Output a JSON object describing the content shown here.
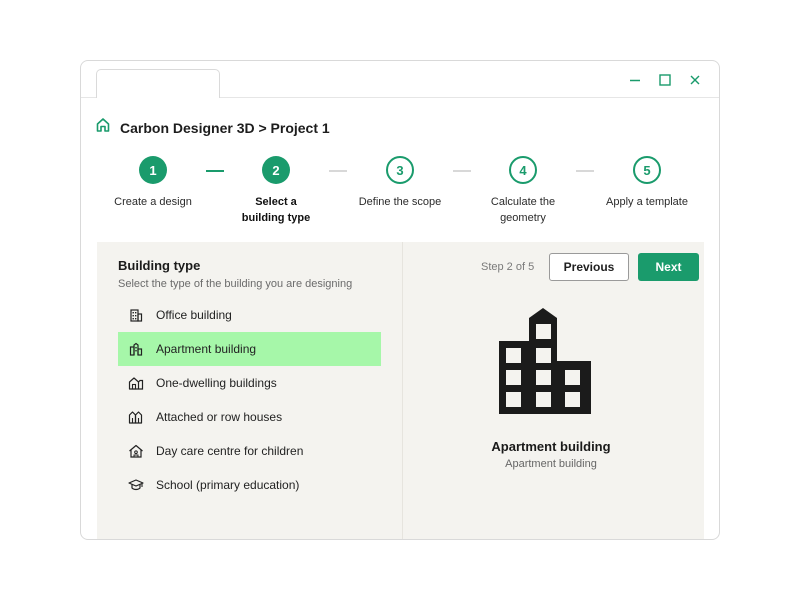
{
  "window": {
    "controls": [
      "minimize-icon",
      "maximize-icon",
      "close-icon"
    ]
  },
  "header": {
    "title": "Carbon Designer 3D > Project 1",
    "icon": "home-icon"
  },
  "stepper": {
    "steps": [
      {
        "number": "1",
        "label_line1": "Create a design",
        "label_line2": "",
        "state": "done"
      },
      {
        "number": "2",
        "label_line1": "Select a",
        "label_line2": "building type",
        "state": "current"
      },
      {
        "number": "3",
        "label_line1": "Define the scope",
        "label_line2": "",
        "state": "todo"
      },
      {
        "number": "4",
        "label_line1": "Calculate the",
        "label_line2": "geometry",
        "state": "todo"
      },
      {
        "number": "5",
        "label_line1": "Apply a template",
        "label_line2": "",
        "state": "todo"
      }
    ]
  },
  "left_panel": {
    "title": "Building type",
    "subtitle": "Select the type of the building you are designing",
    "items": [
      {
        "label": "Office building",
        "icon": "office-building-icon",
        "selected": false
      },
      {
        "label": "Apartment building",
        "icon": "apartment-building-icon",
        "selected": true
      },
      {
        "label": "One-dwelling buildings",
        "icon": "house-icon",
        "selected": false
      },
      {
        "label": "Attached or row houses",
        "icon": "row-houses-icon",
        "selected": false
      },
      {
        "label": "Day care centre for children",
        "icon": "daycare-icon",
        "selected": false
      },
      {
        "label": "School (primary education)",
        "icon": "graduation-cap-icon",
        "selected": false
      }
    ]
  },
  "right_panel": {
    "step_count": "Step 2 of 5",
    "previous_label": "Previous",
    "next_label": "Next",
    "preview_title": "Apartment building",
    "preview_subtitle": "Apartment building",
    "preview_icon": "apartment-building-illustration-icon"
  },
  "colors": {
    "accent": "#1a9b6c",
    "selected_bg": "#a6f7a9",
    "panel_bg": "#f4f3ef"
  }
}
